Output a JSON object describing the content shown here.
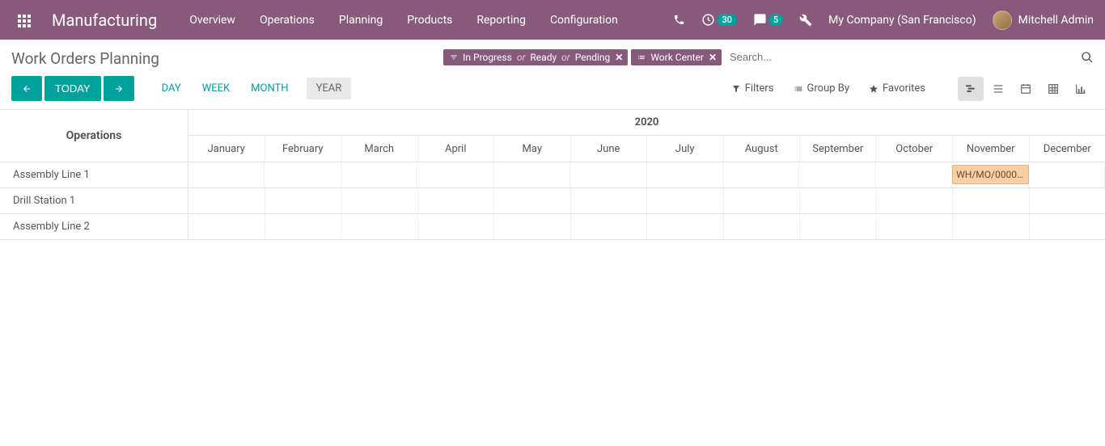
{
  "header": {
    "brand": "Manufacturing",
    "menu": [
      "Overview",
      "Operations",
      "Planning",
      "Products",
      "Reporting",
      "Configuration"
    ],
    "activity_badge": "30",
    "messages_badge": "5",
    "company": "My Company (San Francisco)",
    "username": "Mitchell Admin"
  },
  "page": {
    "title": "Work Orders Planning"
  },
  "search": {
    "filter_facet": {
      "values": [
        "In Progress",
        "Ready",
        "Pending"
      ]
    },
    "group_facet": {
      "label": "Work Center"
    },
    "placeholder": "Search..."
  },
  "controls": {
    "prev": "←",
    "today": "TODAY",
    "next": "→",
    "ranges": {
      "day": "DAY",
      "week": "WEEK",
      "month": "MONTH",
      "year": "YEAR"
    },
    "filters": "Filters",
    "groupby": "Group By",
    "favorites": "Favorites"
  },
  "gantt": {
    "ops_header": "Operations",
    "year": "2020",
    "months": [
      "January",
      "February",
      "March",
      "April",
      "May",
      "June",
      "July",
      "August",
      "September",
      "October",
      "November",
      "December"
    ],
    "rows": [
      {
        "label": "Assembly Line 1"
      },
      {
        "label": "Drill Station 1"
      },
      {
        "label": "Assembly Line 2"
      }
    ],
    "task_label": "WH/MO/0000…"
  }
}
